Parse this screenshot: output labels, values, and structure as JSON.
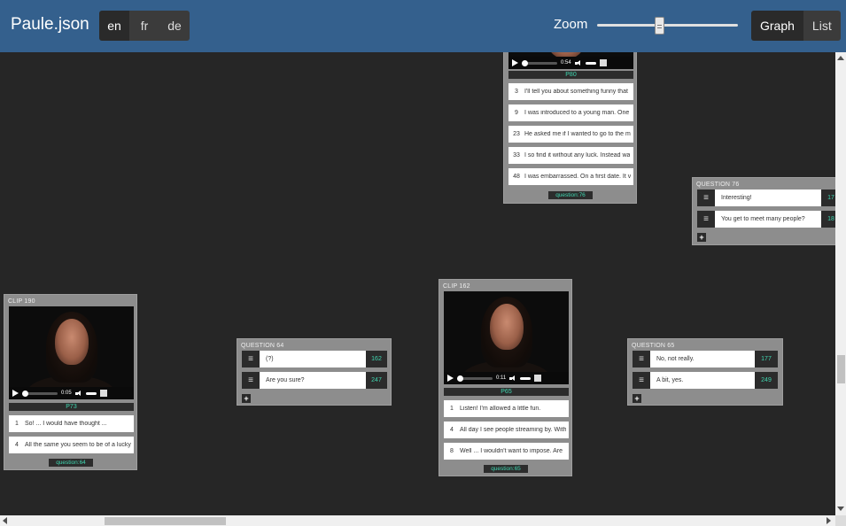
{
  "app": {
    "title": "Paule.json"
  },
  "languages": [
    {
      "label": "en",
      "active": true
    },
    {
      "label": "fr",
      "active": false
    },
    {
      "label": "de",
      "active": false
    }
  ],
  "zoom": {
    "label": "Zoom",
    "value": 0.43
  },
  "views": [
    {
      "label": "Graph",
      "active": true
    },
    {
      "label": "List",
      "active": false
    }
  ],
  "clips": {
    "clip_190": {
      "title": "CLIP 190",
      "time": "0:05",
      "label": "P73",
      "answers": [
        {
          "num": "1",
          "text": "So! ... I would have thought ..."
        },
        {
          "num": "4",
          "text": "All the same you seem to be of a lucky"
        }
      ],
      "link": "question:64"
    },
    "clip_162": {
      "title": "CLIP 162",
      "time": "0:11",
      "label": "P65",
      "answers": [
        {
          "num": "1",
          "text": "Listen! I'm allowed a little fun."
        },
        {
          "num": "4",
          "text": "All day I see people streaming by. With"
        },
        {
          "num": "8",
          "text": "Well ... I wouldn't want to impose. Are"
        }
      ],
      "link": "question:65"
    },
    "clip_top": {
      "time": "0:54",
      "label": "P80",
      "answers": [
        {
          "num": "3",
          "text": "I'll tell you about something funny that"
        },
        {
          "num": "9",
          "text": "I was introduced to a young man. One"
        },
        {
          "num": "23",
          "text": "He asked me if I wanted to go to the m"
        },
        {
          "num": "33",
          "text": "I so find it without any luck. Instead wa"
        },
        {
          "num": "48",
          "text": "I was embarrassed. On a first date. It v"
        }
      ],
      "link": "question:76"
    }
  },
  "questions": {
    "question_64": {
      "title": "QUESTION 64",
      "rows": [
        {
          "text": "(?)",
          "link": "162"
        },
        {
          "text": "Are you sure?",
          "link": "247"
        }
      ],
      "add": "+"
    },
    "question_65": {
      "title": "QUESTION 65",
      "rows": [
        {
          "text": "No, not really.",
          "link": "177"
        },
        {
          "text": "A bit, yes.",
          "link": "249"
        }
      ],
      "add": "+"
    },
    "question_76": {
      "title": "QUESTION 76",
      "rows": [
        {
          "text": "Interesting!",
          "link": "17"
        },
        {
          "text": "You get to meet many people?",
          "link": "18"
        }
      ],
      "add": "+"
    }
  },
  "icons": {
    "handle": "≡",
    "play": "play-icon",
    "volume": "volume-icon",
    "fullscreen": "fullscreen-icon"
  },
  "colors": {
    "header": "#34608d",
    "canvas": "#262626",
    "node": "#8d8d8d",
    "link_text": "#3fd6b0"
  }
}
